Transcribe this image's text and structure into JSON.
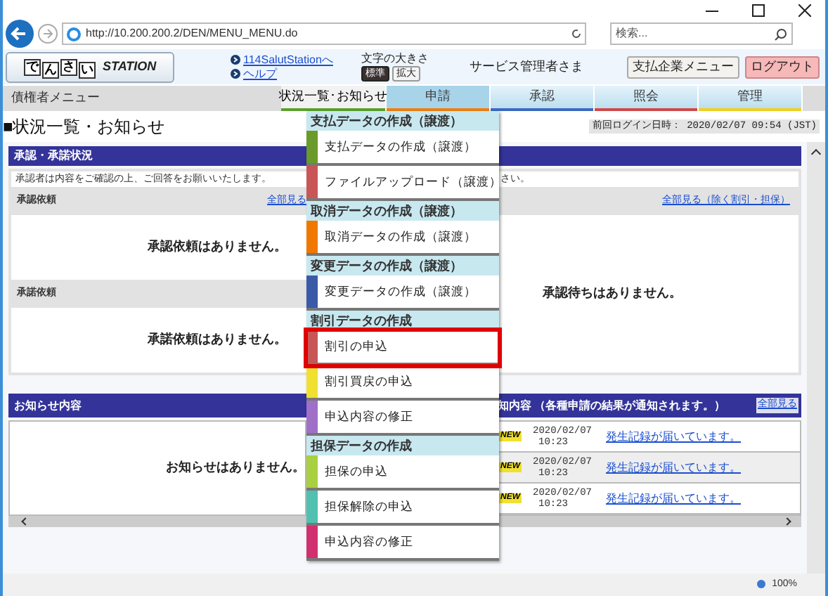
{
  "browser": {
    "url": "http://10.200.200.2/DEN/MENU_MENU.do",
    "search_placeholder": "検索...",
    "zoom": "100%"
  },
  "header": {
    "logo_chars": [
      "で",
      "ん",
      "さ",
      "い"
    ],
    "logo_word": "STATION",
    "links": [
      "114SalutStationへ",
      "ヘルプ"
    ],
    "font_size_label": "文字の大きさ",
    "font_sizes": [
      {
        "label": "標準",
        "selected": true
      },
      {
        "label": "拡大",
        "selected": false
      }
    ],
    "user": "サービス管理者さま",
    "buttons": [
      {
        "label": "支払企業メニュー",
        "kind": "plain"
      },
      {
        "label": "ログアウト",
        "kind": "logout"
      }
    ]
  },
  "nav": {
    "menu_label": "債権者メニュー",
    "tabs": [
      {
        "label": "状況一覧･お知らせ",
        "selected": true,
        "expanded": false,
        "color": "#5aa02c"
      },
      {
        "label": "申請",
        "selected": false,
        "expanded": true,
        "color": "#f08010"
      },
      {
        "label": "承認",
        "selected": false,
        "expanded": false,
        "color": "#3a6ac0"
      },
      {
        "label": "照会",
        "selected": false,
        "expanded": false,
        "color": "#d04848"
      },
      {
        "label": "管理",
        "selected": false,
        "expanded": false,
        "color": "#f0d020"
      }
    ]
  },
  "page_title": "■状況一覧・お知らせ",
  "last_login": "前回ログイン日時：  2020/02/07 09:54  (JST)",
  "approval": {
    "title": "承認・承諾状況",
    "note_left": "承認者は内容をご確認の上、ご回答をお願いいたします。",
    "note_right": "さい。",
    "left": [
      {
        "title": "承認依頼",
        "link": "全部見る",
        "empty": "承認依頼はありません。"
      },
      {
        "title": "承諾依頼",
        "empty": "承諾依頼はありません。"
      }
    ],
    "right": {
      "link": "全部見る（除く割引・担保）",
      "empty": "承認待ちはありません。"
    }
  },
  "notices": {
    "title": "お知らせ内容",
    "empty": "お知らせはありません。"
  },
  "results": {
    "title": "知内容 （各種申請の結果が通知されます。）",
    "button": "全部見る",
    "rows": [
      {
        "badge": "NEW",
        "date": "2020/02/07",
        "time": "10:23",
        "link": "発生記録が届いています。"
      },
      {
        "badge": "NEW",
        "date": "2020/02/07",
        "time": "10:23",
        "link": "発生記録が届いています。"
      },
      {
        "badge": "NEW",
        "date": "2020/02/07",
        "time": "10:23",
        "link": "発生記録が届いています。"
      }
    ]
  },
  "dropdown": [
    {
      "kind": "header",
      "label": "支払データの作成（譲渡）"
    },
    {
      "kind": "item",
      "label": "支払データの作成（譲渡）",
      "color": "#6a9a2a",
      "selected": false
    },
    {
      "kind": "item",
      "label": "ファイルアップロード（譲渡）",
      "color": "#c85656",
      "selected": false
    },
    {
      "kind": "header",
      "label": "取消データの作成（譲渡）"
    },
    {
      "kind": "item",
      "label": "取消データの作成（譲渡）",
      "color": "#f07800",
      "selected": false
    },
    {
      "kind": "header",
      "label": "変更データの作成（譲渡）"
    },
    {
      "kind": "item",
      "label": "変更データの作成（譲渡）",
      "color": "#3a5aa8",
      "selected": false
    },
    {
      "kind": "header",
      "label": "割引データの作成"
    },
    {
      "kind": "item",
      "label": "割引の申込",
      "color": "#c85656",
      "selected": true
    },
    {
      "kind": "item",
      "label": "割引買戻の申込",
      "color": "#f0e030",
      "selected": false
    },
    {
      "kind": "item",
      "label": "申込内容の修正",
      "color": "#a070c8",
      "selected": false
    },
    {
      "kind": "header",
      "label": "担保データの作成"
    },
    {
      "kind": "item",
      "label": "担保の申込",
      "color": "#a8d040",
      "selected": false
    },
    {
      "kind": "item",
      "label": "担保解除の申込",
      "color": "#50c0b0",
      "selected": false
    },
    {
      "kind": "item",
      "label": "申込内容の修正",
      "color": "#d03070",
      "selected": false
    }
  ]
}
